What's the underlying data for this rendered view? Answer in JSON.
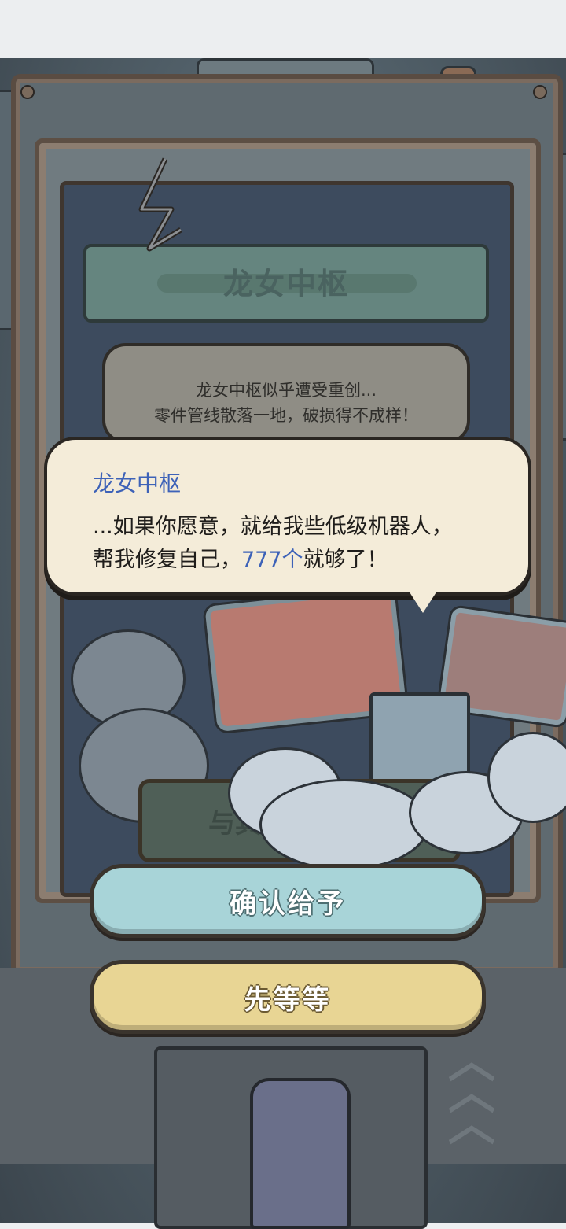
{
  "dialog": {
    "title": "龙女中枢",
    "description_line1": "龙女中枢似乎遭受重创...",
    "description_line2": "零件管线散落一地，破损得不成样！"
  },
  "speech": {
    "speaker": "龙女中枢",
    "line1": "...如果你愿意，就给我些低级机器人，",
    "line2_prefix": "帮我修复自己，",
    "line2_highlight": "777个",
    "line2_suffix": "就够了！"
  },
  "background_button": {
    "label_partial": "与其"
  },
  "buttons": {
    "confirm_label": "确认给予",
    "wait_label": "先等等"
  },
  "colors": {
    "speaker_blue": "#3d62b8",
    "confirm_bg": "#a8d4d8",
    "wait_bg": "#e8d594",
    "bubble_bg": "#f4ecd9"
  }
}
